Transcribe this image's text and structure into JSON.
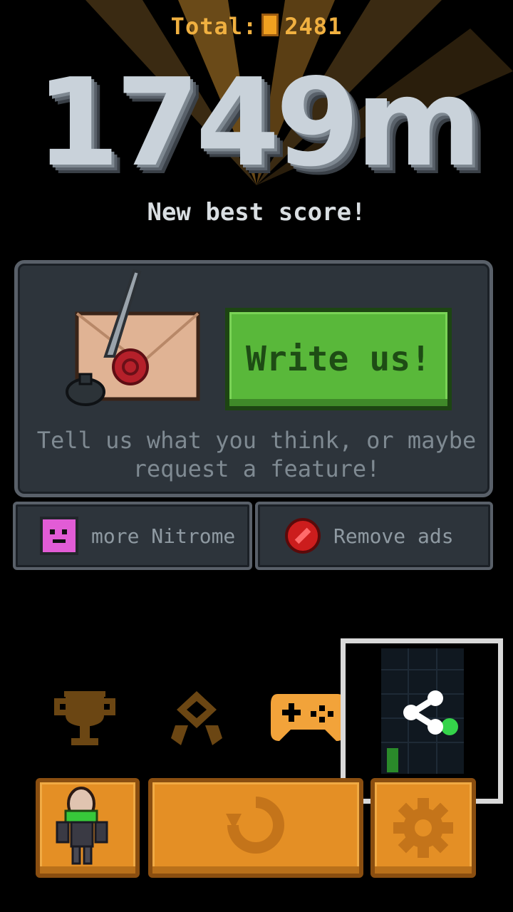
{
  "header": {
    "total_label": "Total:",
    "total_coins": "2481"
  },
  "score": {
    "distance": "1749m",
    "best_label": "New best score!"
  },
  "feedback": {
    "button_label": "Write us!",
    "message": "Tell us what you think, or maybe request a feature!"
  },
  "links": {
    "more_label": "more Nitrome",
    "remove_ads_label": "Remove ads"
  },
  "icons": {
    "trophy": "trophy-icon",
    "medal": "medal-icon",
    "gamepad": "gamepad-icon",
    "share": "share-icon",
    "retry": "retry-icon",
    "settings": "gear-icon"
  },
  "colors": {
    "accent": "#e48f25",
    "write_button": "#59b83a",
    "coin": "#f0b040"
  }
}
